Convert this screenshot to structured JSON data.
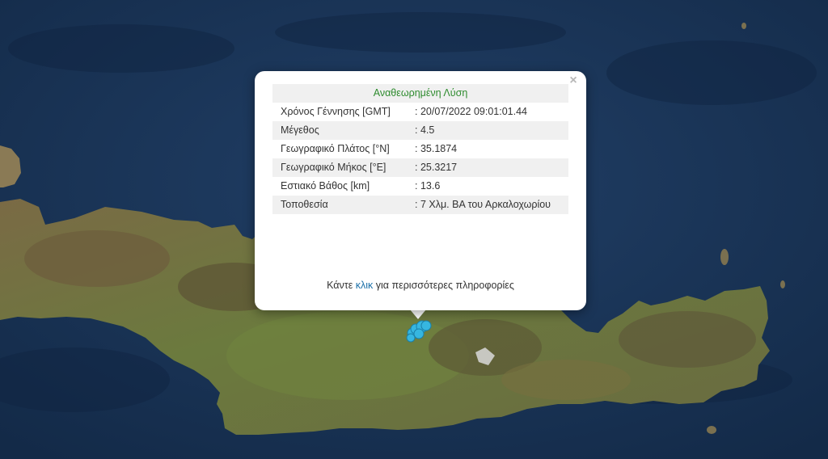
{
  "colors": {
    "sea": "#1b3558",
    "land": "#6f6d3e",
    "title_green": "#2e8b2e",
    "marker": "#36b6e0",
    "link": "#1a6fa8"
  },
  "popup": {
    "close_icon": "×",
    "title": "Αναθεωρημένη Λύση",
    "rows": [
      {
        "label": "Χρόνος Γέννησης [GMT]",
        "value": ": 20/07/2022 09:01:01.44"
      },
      {
        "label": "Μέγεθος",
        "value": ": 4.5"
      },
      {
        "label": "Γεωγραφικό Πλάτος [°N]",
        "value": ": 35.1874"
      },
      {
        "label": "Γεωγραφικό Μήκος [°E]",
        "value": ": 25.3217"
      },
      {
        "label": "Εστιακό Βάθος [km]",
        "value": ": 13.6"
      },
      {
        "label": "Τοποθεσία",
        "value": ": 7 Χλμ. ΒΑ του Αρκαλοχωρίου"
      }
    ],
    "footer_prefix": "Κάντε",
    "footer_link": "κλικ",
    "footer_suffix": "για περισσότερες πληροφορίες"
  }
}
